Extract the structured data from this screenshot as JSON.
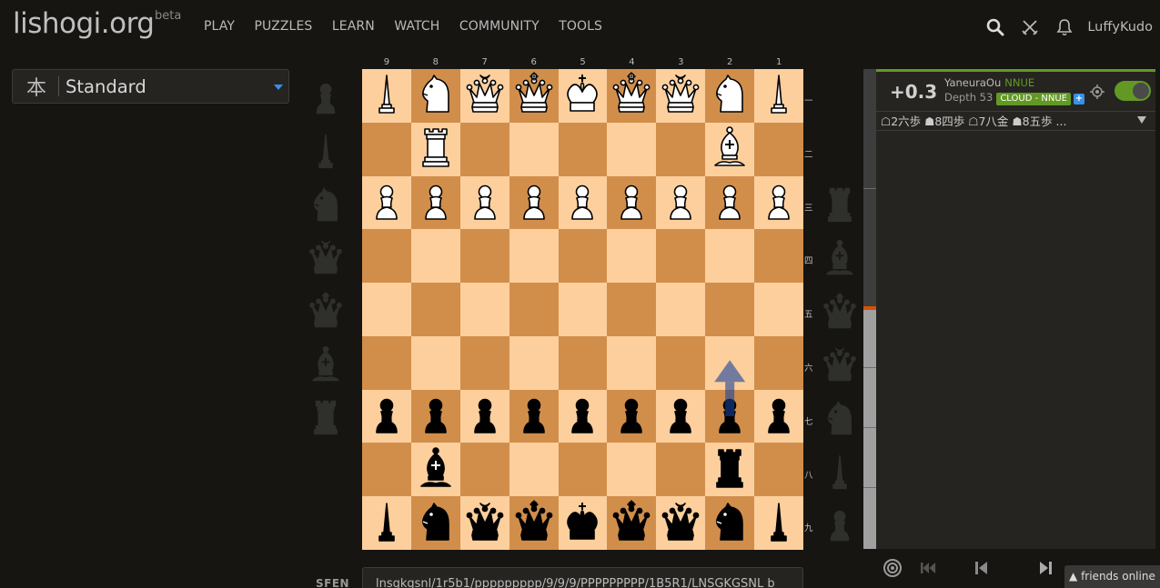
{
  "header": {
    "logo": "lishogi.org",
    "beta": "beta",
    "nav": [
      "PLAY",
      "PUZZLES",
      "LEARN",
      "WATCH",
      "COMMUNITY",
      "TOOLS"
    ],
    "username": "LuffyKudo"
  },
  "variant": {
    "icon": "本",
    "label": "Standard"
  },
  "board": {
    "files": [
      "9",
      "8",
      "7",
      "6",
      "5",
      "4",
      "3",
      "2",
      "1"
    ],
    "ranks": [
      "一",
      "二",
      "三",
      "四",
      "五",
      "六",
      "七",
      "八",
      "九"
    ],
    "rows": [
      [
        "wL",
        "wN",
        "wS",
        "wG",
        "wK",
        "wG",
        "wS",
        "wN",
        "wL"
      ],
      [
        "",
        "wR",
        "",
        "",
        "",
        "",
        "",
        "wB",
        ""
      ],
      [
        "wP",
        "wP",
        "wP",
        "wP",
        "wP",
        "wP",
        "wP",
        "wP",
        "wP"
      ],
      [
        "",
        "",
        "",
        "",
        "",
        "",
        "",
        "",
        ""
      ],
      [
        "",
        "",
        "",
        "",
        "",
        "",
        "",
        "",
        ""
      ],
      [
        "",
        "",
        "",
        "",
        "",
        "",
        "",
        "",
        ""
      ],
      [
        "bP",
        "bP",
        "bP",
        "bP",
        "bP",
        "bP",
        "bP",
        "bP",
        "bP"
      ],
      [
        "",
        "bB",
        "",
        "",
        "",
        "",
        "",
        "bR",
        ""
      ],
      [
        "bL",
        "bN",
        "bS",
        "bG",
        "bK",
        "bG",
        "bS",
        "bN",
        "bL"
      ]
    ],
    "arrow": {
      "from": "2七",
      "to": "2六",
      "color": "#15439c"
    }
  },
  "pockets": {
    "left": [
      "pawn",
      "lance",
      "knight",
      "silver",
      "gold",
      "bishop",
      "rook"
    ],
    "right": [
      "rook",
      "bishop",
      "gold",
      "silver",
      "knight",
      "lance",
      "pawn"
    ]
  },
  "engine": {
    "eval": "+0.3",
    "name": "YaneuraOu",
    "tag": "NNUE",
    "depth": "Depth 53",
    "cloud": "CLOUD - NNUE",
    "plus": "+",
    "pv": "☖2六歩 ☗8四歩 ☖7八金 ☗8五歩 ...",
    "eval_white_fraction": 0.5
  },
  "sfen": {
    "label": "SFEN",
    "value": "lnsgkgsnl/1r5b1/ppppppppp/9/9/9/PPPPPPPPP/1B5R1/LNSGKGSNL b"
  },
  "friends": "friends online",
  "colors": {
    "light": "#fdcf9d",
    "dark": "#d18e4b",
    "accent": "#629924",
    "link": "#3692e7"
  }
}
